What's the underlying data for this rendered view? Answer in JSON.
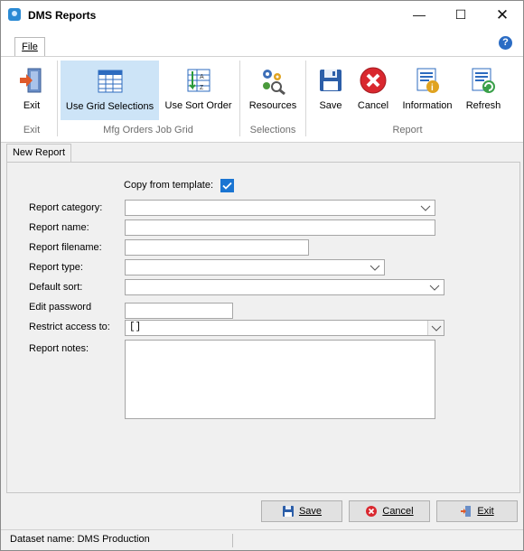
{
  "window": {
    "title": "DMS Reports",
    "min_glyph": "—",
    "max_glyph": "☐",
    "close_glyph": "✕"
  },
  "ribbon_tabs": {
    "file": "File",
    "help_glyph": "?"
  },
  "ribbon": {
    "exit": "Exit",
    "use_grid_selections": "Use Grid Selections",
    "use_sort_order": "Use Sort Order",
    "resources": "Resources",
    "save": "Save",
    "cancel": "Cancel",
    "information": "Information",
    "refresh": "Refresh",
    "groups": {
      "exit": "Exit",
      "mfg_orders_job_grid": "Mfg Orders Job Grid",
      "selections": "Selections",
      "report": "Report"
    }
  },
  "doc_tab": "New Report",
  "form": {
    "copy_from_template_label": "Copy from template:",
    "copy_from_template_checked": true,
    "report_category_label": "Report category:",
    "report_category_value": "",
    "report_name_label": "Report name:",
    "report_name_value": "",
    "report_filename_label": "Report filename:",
    "report_filename_value": "",
    "report_type_label": "Report type:",
    "report_type_value": "",
    "default_sort_label": "Default sort:",
    "default_sort_value": "",
    "edit_password_label": "Edit password",
    "edit_password_value": "",
    "restrict_access_label": "Restrict access to:",
    "restrict_access_value": "[]",
    "report_notes_label": "Report notes:",
    "report_notes_value": ""
  },
  "buttons": {
    "save": "Save",
    "cancel": "Cancel",
    "exit": "Exit"
  },
  "status": {
    "dataset": "Dataset name:  DMS Production"
  },
  "colors": {
    "accent": "#1a75d2",
    "selected": "#cde4f7",
    "cancel_red": "#d9282f"
  }
}
